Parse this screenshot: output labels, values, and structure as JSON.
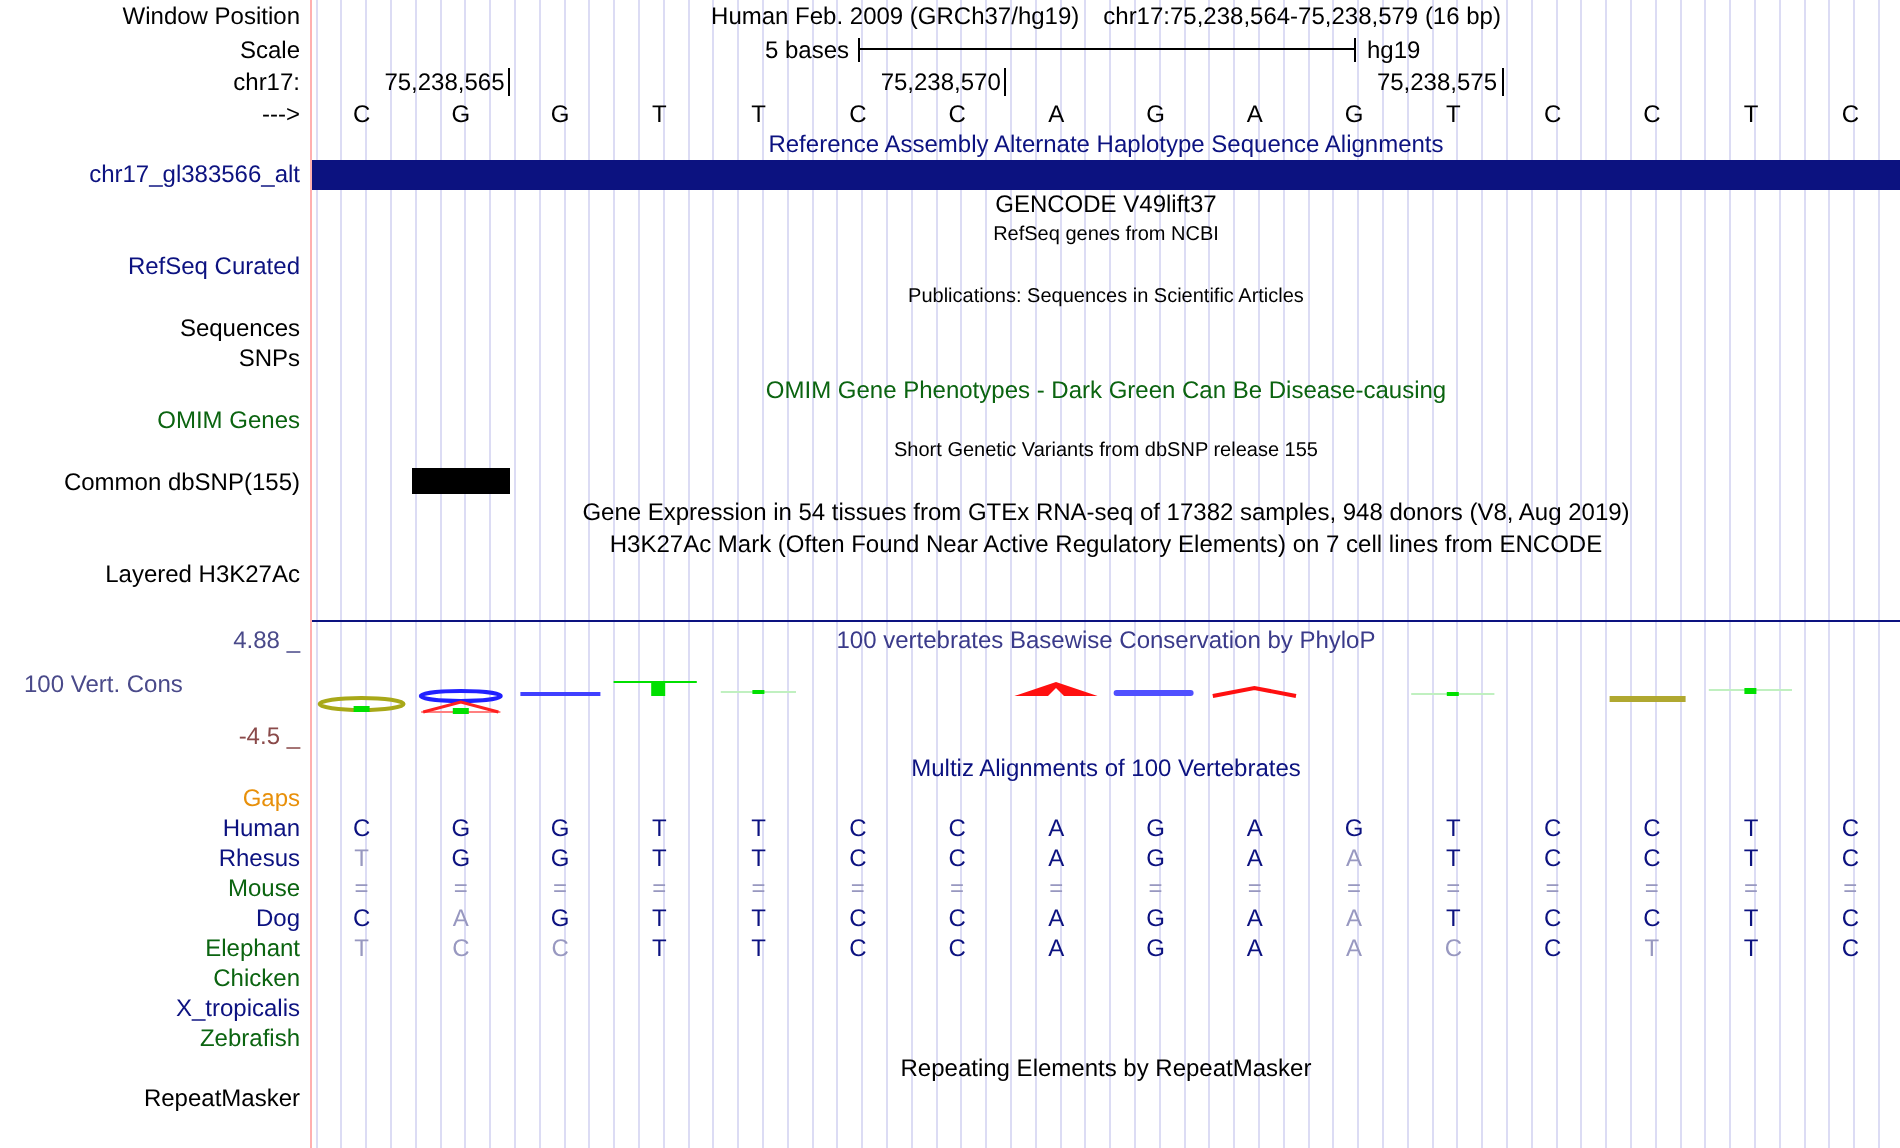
{
  "header": {
    "window_position_label": "Window Position",
    "genome": "Human Feb. 2009 (GRCh37/hg19)",
    "position": "chr17:75,238,564-75,238,579 (16 bp)",
    "scale_label": "Scale",
    "scale": "5 bases",
    "assembly": "hg19",
    "chrom_label": "chr17:",
    "positions": [
      "75,238,565",
      "75,238,570",
      "75,238,575"
    ],
    "strand_label": "--->",
    "bases": [
      "C",
      "G",
      "G",
      "T",
      "T",
      "C",
      "C",
      "A",
      "G",
      "A",
      "G",
      "T",
      "C",
      "C",
      "T",
      "C"
    ]
  },
  "tracks": [
    {
      "kind": "title",
      "text": "Reference Assembly Alternate Haplotype Sequence Alignments",
      "color": "#0c1280"
    },
    {
      "kind": "alt_bar",
      "label": "chr17_gl383566_alt",
      "color": "#0c1280"
    },
    {
      "kind": "title",
      "text": "GENCODE V49lift37",
      "color": "#000000"
    },
    {
      "kind": "subtitle",
      "text": "RefSeq genes from NCBI",
      "color": "#000000"
    },
    {
      "kind": "label",
      "label": "RefSeq Curated",
      "color": "#0c1280"
    },
    {
      "kind": "subtitle",
      "text": "Publications: Sequences in Scientific Articles",
      "color": "#000000"
    },
    {
      "kind": "label",
      "label": "Sequences",
      "color": "#000000"
    },
    {
      "kind": "label",
      "label": "SNPs",
      "color": "#000000"
    },
    {
      "kind": "title",
      "text": "OMIM Gene Phenotypes - Dark Green Can Be Disease-causing",
      "color": "#0b6410"
    },
    {
      "kind": "label",
      "label": "OMIM Genes",
      "color": "#0b6410"
    },
    {
      "kind": "subtitle",
      "text": "Short Genetic Variants from dbSNP release 155",
      "color": "#000000"
    },
    {
      "kind": "snp",
      "label": "Common dbSNP(155)",
      "color": "#000000"
    },
    {
      "kind": "title",
      "text": "Gene Expression in 54 tissues from GTEx RNA-seq of 17382 samples, 948 donors (V8, Aug 2019)",
      "color": "#000000"
    },
    {
      "kind": "title",
      "text": "H3K27Ac Mark (Often Found Near Active Regulatory Elements) on 7 cell lines from ENCODE",
      "color": "#000000"
    },
    {
      "kind": "label",
      "label": "Layered H3K27Ac",
      "color": "#000000"
    }
  ],
  "conservation": {
    "max": "4.88 _",
    "label": "100 Vert. Cons",
    "min": "-4.5 _",
    "title": "100 vertebrates Basewise Conservation by PhyloP"
  },
  "multiz": {
    "title": "Multiz Alignments of 100 Vertebrates",
    "gaps_label": "Gaps",
    "species": [
      {
        "name": "Human",
        "color": "#0c1280",
        "bases": [
          "C",
          "G",
          "G",
          "T",
          "T",
          "C",
          "C",
          "A",
          "G",
          "A",
          "G",
          "T",
          "C",
          "C",
          "T",
          "C"
        ],
        "faded": [
          false,
          false,
          false,
          false,
          false,
          false,
          false,
          false,
          false,
          false,
          false,
          false,
          false,
          false,
          false,
          false
        ]
      },
      {
        "name": "Rhesus",
        "color": "#0c1280",
        "bases": [
          "T",
          "G",
          "G",
          "T",
          "T",
          "C",
          "C",
          "A",
          "G",
          "A",
          "A",
          "T",
          "C",
          "C",
          "T",
          "C"
        ],
        "faded": [
          true,
          false,
          false,
          false,
          false,
          false,
          false,
          false,
          false,
          false,
          true,
          false,
          false,
          false,
          false,
          false
        ]
      },
      {
        "name": "Mouse",
        "color": "#0b6410",
        "bases": [
          "=",
          "=",
          "=",
          "=",
          "=",
          "=",
          "=",
          "=",
          "=",
          "=",
          "=",
          "=",
          "=",
          "=",
          "=",
          "="
        ],
        "faded": [
          true,
          true,
          true,
          true,
          true,
          true,
          true,
          true,
          true,
          true,
          true,
          true,
          true,
          true,
          true,
          true
        ]
      },
      {
        "name": "Dog",
        "color": "#0c1280",
        "bases": [
          "C",
          "A",
          "G",
          "T",
          "T",
          "C",
          "C",
          "A",
          "G",
          "A",
          "A",
          "T",
          "C",
          "C",
          "T",
          "C"
        ],
        "faded": [
          false,
          true,
          false,
          false,
          false,
          false,
          false,
          false,
          false,
          false,
          true,
          false,
          false,
          false,
          false,
          false
        ]
      },
      {
        "name": "Elephant",
        "color": "#0b6410",
        "bases": [
          "T",
          "C",
          "C",
          "T",
          "T",
          "C",
          "C",
          "A",
          "G",
          "A",
          "A",
          "C",
          "C",
          "T",
          "T",
          "C"
        ],
        "faded": [
          true,
          true,
          true,
          false,
          false,
          false,
          false,
          false,
          false,
          false,
          true,
          true,
          false,
          true,
          false,
          false
        ]
      },
      {
        "name": "Chicken",
        "color": "#0b6410"
      },
      {
        "name": "X_tropicalis",
        "color": "#0c1280"
      },
      {
        "name": "Zebrafish",
        "color": "#0b6410"
      }
    ]
  },
  "repeats": {
    "title": "Repeating Elements by RepeatMasker",
    "label": "RepeatMasker"
  }
}
